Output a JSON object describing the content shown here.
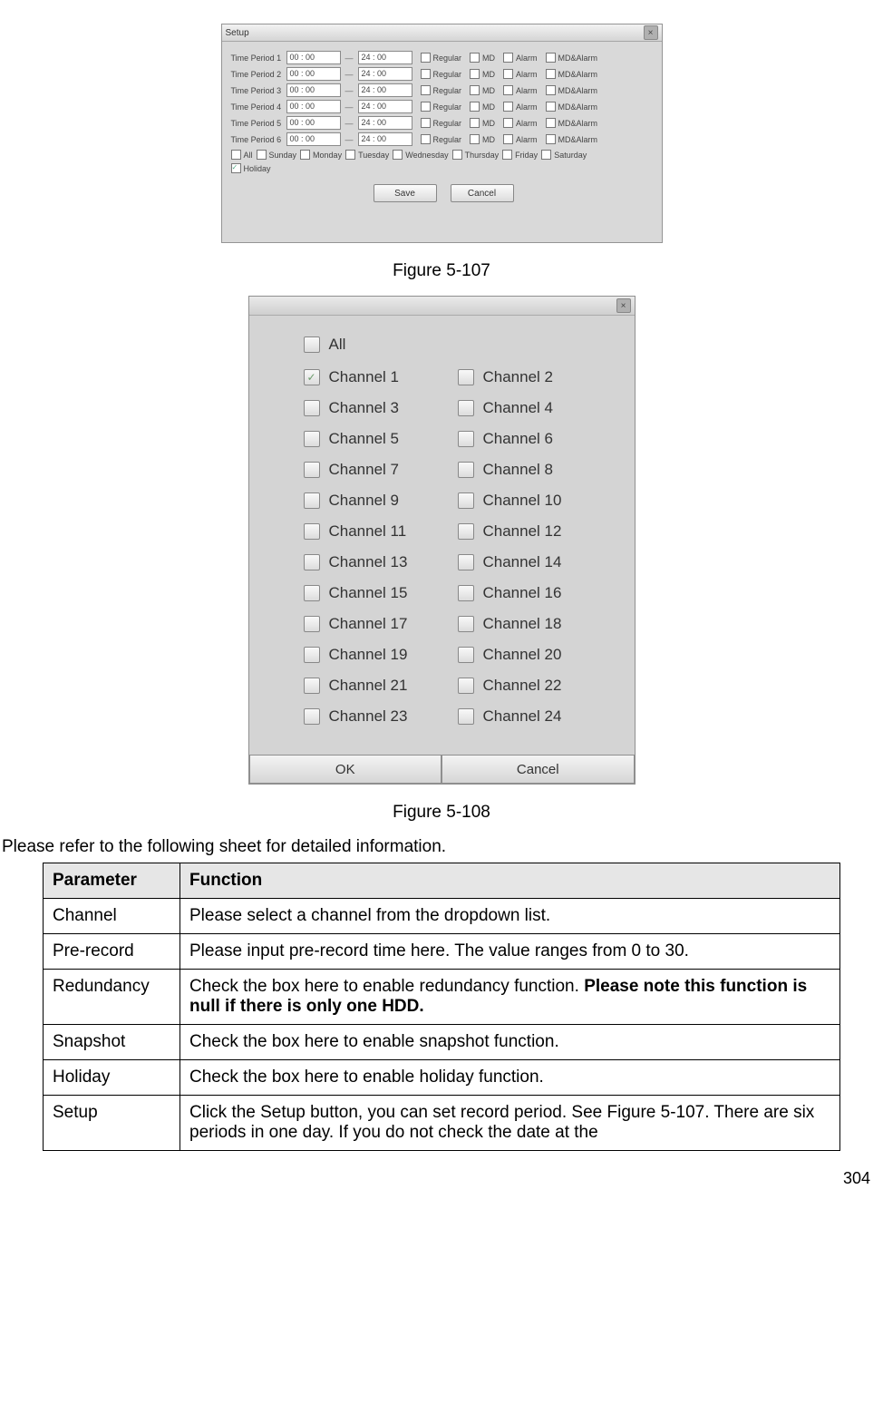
{
  "setupDialog": {
    "title": "Setup",
    "periods": [
      {
        "label": "Time Period 1",
        "start": "00 : 00",
        "end": "24 : 00"
      },
      {
        "label": "Time Period 2",
        "start": "00 : 00",
        "end": "24 : 00"
      },
      {
        "label": "Time Period 3",
        "start": "00 : 00",
        "end": "24 : 00"
      },
      {
        "label": "Time Period 4",
        "start": "00 : 00",
        "end": "24 : 00"
      },
      {
        "label": "Time Period 5",
        "start": "00 : 00",
        "end": "24 : 00"
      },
      {
        "label": "Time Period 6",
        "start": "00 : 00",
        "end": "24 : 00"
      }
    ],
    "periodChecks": [
      "Regular",
      "MD",
      "Alarm",
      "MD&Alarm"
    ],
    "days": [
      "All",
      "Sunday",
      "Monday",
      "Tuesday",
      "Wednesday",
      "Thursday",
      "Friday",
      "Saturday"
    ],
    "holiday": "Holiday",
    "save": "Save",
    "cancel": "Cancel"
  },
  "figure107": "Figure 5-107",
  "channelDialog": {
    "all": "All",
    "channels": [
      "Channel 1",
      "Channel 2",
      "Channel 3",
      "Channel 4",
      "Channel 5",
      "Channel 6",
      "Channel 7",
      "Channel 8",
      "Channel 9",
      "Channel 10",
      "Channel 11",
      "Channel 12",
      "Channel 13",
      "Channel 14",
      "Channel 15",
      "Channel 16",
      "Channel 17",
      "Channel 18",
      "Channel 19",
      "Channel 20",
      "Channel 21",
      "Channel 22",
      "Channel 23",
      "Channel 24"
    ],
    "channel1Checked": true,
    "ok": "OK",
    "cancel": "Cancel"
  },
  "figure108": "Figure 5-108",
  "leadText": "Please refer to the following sheet for detailed information.",
  "table": {
    "head": {
      "param": "Parameter",
      "func": "Function"
    },
    "rows": [
      {
        "p": "Channel",
        "f": "Please select a channel from the dropdown list."
      },
      {
        "p": "Pre-record",
        "f": "Please input pre-record time here. The value ranges from 0 to 30."
      },
      {
        "p": "Redundancy",
        "f": "Check the box here to enable redundancy function. <b>Please note this function is null if there is only one HDD.</b>"
      },
      {
        "p": "Snapshot",
        "f": "Check the box here to enable snapshot function."
      },
      {
        "p": "Holiday",
        "f": "Check the box here to enable holiday function."
      },
      {
        "p": "Setup",
        "f": "Click the Setup button, you can set record period. See Figure 5-107. There are six periods in one day. If you do not check the date at the"
      }
    ]
  },
  "pageNum": "304"
}
